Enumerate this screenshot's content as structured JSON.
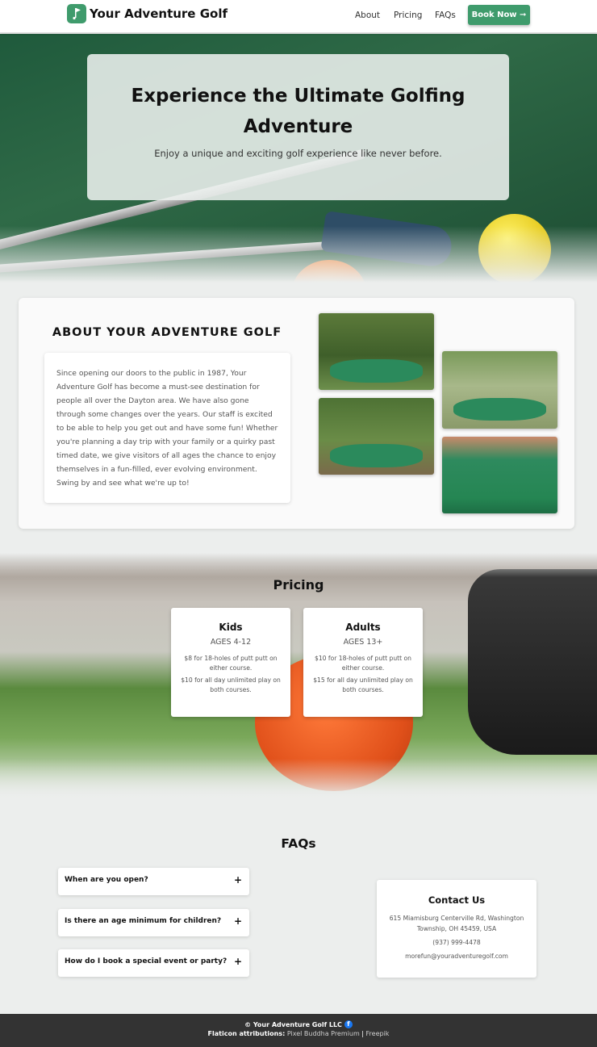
{
  "nav": {
    "brand": "Your Adventure Golf",
    "links": [
      "About",
      "Pricing",
      "FAQs"
    ],
    "cta": "Book Now ➞",
    "accent": "#3f9b6c"
  },
  "hero": {
    "title": "Experience the Ultimate Golfing Adventure",
    "subtitle": "Enjoy a unique and exciting golf experience like never before."
  },
  "about": {
    "title": "ABOUT YOUR ADVENTURE GOLF",
    "body": "Since opening our doors to the public in 1987, Your Adventure Golf has become a must-see destination for people all over the Dayton area. We have also gone through some changes over the years. Our staff is excited to be able to help you get out and have some fun! Whether you're planning a day trip with your family or a quirky past timed date, we give visitors of all ages the chance to enjoy themselves in a fun-filled, ever evolving environment. Swing by and see what we're up to!"
  },
  "pricing": {
    "title": "Pricing",
    "cards": [
      {
        "name": "Kids",
        "ages": "AGES 4-12",
        "line1": "$8 for 18-holes of putt putt on either course.",
        "line2": "$10 for all day unlimited play on both courses."
      },
      {
        "name": "Adults",
        "ages": "AGES 13+",
        "line1": "$10 for 18-holes of putt putt on either course.",
        "line2": "$15 for all day unlimited play on both courses."
      }
    ]
  },
  "faq": {
    "title": "FAQs",
    "items": [
      "When are you open?",
      "Is there an age minimum for children?",
      "How do I book a special event or party?"
    ],
    "toggle": "+"
  },
  "contact": {
    "title": "Contact Us",
    "address": "615 Miamisburg Centerville Rd, Washington Township, OH 45459, USA",
    "phone": "(937) 999-4478",
    "email": "morefun@youradventuregolf.com"
  },
  "footer": {
    "copyright": "© Your Adventure Golf LLC",
    "attrib_label": "Flaticon attributions:",
    "attrib_link1": "Pixel Buddha Premium",
    "separator": "|",
    "attrib_link2": "Freepik"
  }
}
